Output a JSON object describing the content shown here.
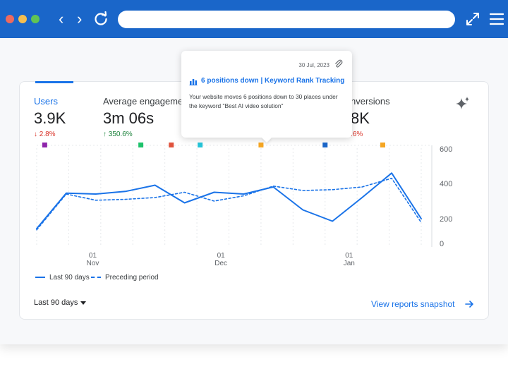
{
  "metrics": [
    {
      "label": "Users",
      "value": "3.9K",
      "delta": "↓ 2.8%",
      "direction": "down"
    },
    {
      "label": "Average engagemen",
      "value": "3m 06s",
      "delta": "↑ 350.6%",
      "direction": "up"
    },
    {
      "label": "nversions",
      "value": "8K",
      "delta": ".6%",
      "direction": "down"
    }
  ],
  "tooltip": {
    "date": "30 Jul, 2023",
    "title": "6 positions down | Keyword Rank Tracking",
    "body": "Your website moves 6 positions down to 30 places under the keyword \"Best AI video solution\""
  },
  "chart_data": {
    "type": "line",
    "x": [
      0,
      1,
      2,
      3,
      4,
      5,
      6,
      7,
      8,
      9,
      10,
      11,
      12
    ],
    "x_tick_labels": [
      {
        "day": "01",
        "month": "Nov",
        "at": 1.75
      },
      {
        "day": "01",
        "month": "Dec",
        "at": 5.75
      },
      {
        "day": "01",
        "month": "Jan",
        "at": 9.75
      }
    ],
    "series": [
      {
        "name": "Last 90 days",
        "style": "solid",
        "color": "#1a73e8",
        "values": [
          120,
          345,
          340,
          355,
          390,
          290,
          350,
          340,
          380,
          250,
          180,
          320,
          460,
          200
        ]
      },
      {
        "name": "Preceding period",
        "style": "dashed",
        "color": "#1a73e8",
        "values": [
          110,
          340,
          305,
          310,
          320,
          350,
          300,
          330,
          385,
          360,
          365,
          380,
          430,
          170
        ]
      }
    ],
    "y_ticks": [
      0,
      200,
      400,
      600
    ],
    "ylim": [
      0,
      600
    ],
    "markers": [
      {
        "at": 0.25,
        "color": "#8e24aa"
      },
      {
        "at": 3.25,
        "color": "#1ec26b"
      },
      {
        "at": 4.2,
        "color": "#e0533d"
      },
      {
        "at": 5.1,
        "color": "#25c4d8"
      },
      {
        "at": 7.0,
        "color": "#f5a623"
      },
      {
        "at": 9.0,
        "color": "#1a66c9"
      },
      {
        "at": 10.8,
        "color": "#f5a623"
      }
    ],
    "legend_position": "bottom-left",
    "grid": "vertical"
  },
  "footer": {
    "range_label": "Last 90 days",
    "snapshot_label": "View reports snapshot"
  },
  "colors": {
    "browser_bar": "#1a66c9",
    "accent": "#1a73e8"
  }
}
